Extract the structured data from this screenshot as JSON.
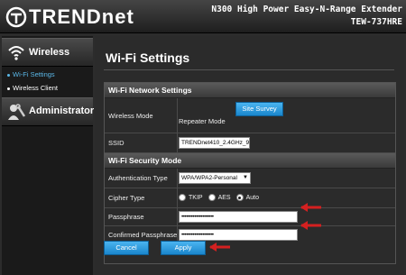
{
  "header": {
    "brand": "TRENDnet",
    "product_name": "N300 High Power Easy-N-Range Extender",
    "model": "TEW-737HRE"
  },
  "sidebar": {
    "sections": [
      {
        "label": "Wireless",
        "icon": "wifi-icon"
      },
      {
        "label": "Administrator",
        "icon": "admin-tools-icon"
      }
    ],
    "items": [
      {
        "label": "Wi-Fi Settings",
        "active": true
      },
      {
        "label": "Wireless Client",
        "active": false
      }
    ],
    "active_color": "#5bb8e8"
  },
  "main": {
    "title": "Wi-Fi Settings",
    "network_section": "Wi-Fi Network Settings",
    "wireless_mode_label": "Wireless Mode",
    "site_survey_label": "Site Survey",
    "wireless_mode_value": "Repeater Mode",
    "ssid_label": "SSID",
    "ssid_value": "TRENDnet410_2.4GHz_9c",
    "security_section": "Wi-Fi Security Mode",
    "auth_label": "Authentication Type",
    "auth_value": "WPA/WPA2-Personal",
    "cipher_label": "Cipher Type",
    "cipher_options": [
      "TKIP",
      "AES",
      "Auto"
    ],
    "cipher_selected": "Auto",
    "passphrase_label": "Passphrase",
    "passphrase_value": "••••••••••••••••••••",
    "confirm_label": "Confirmed Passphrase",
    "confirm_value": "••••••••••••••••••••",
    "cancel_label": "Cancel",
    "apply_label": "Apply"
  },
  "colors": {
    "button_blue": "#1a86cc",
    "arrow_red": "#d42020"
  }
}
